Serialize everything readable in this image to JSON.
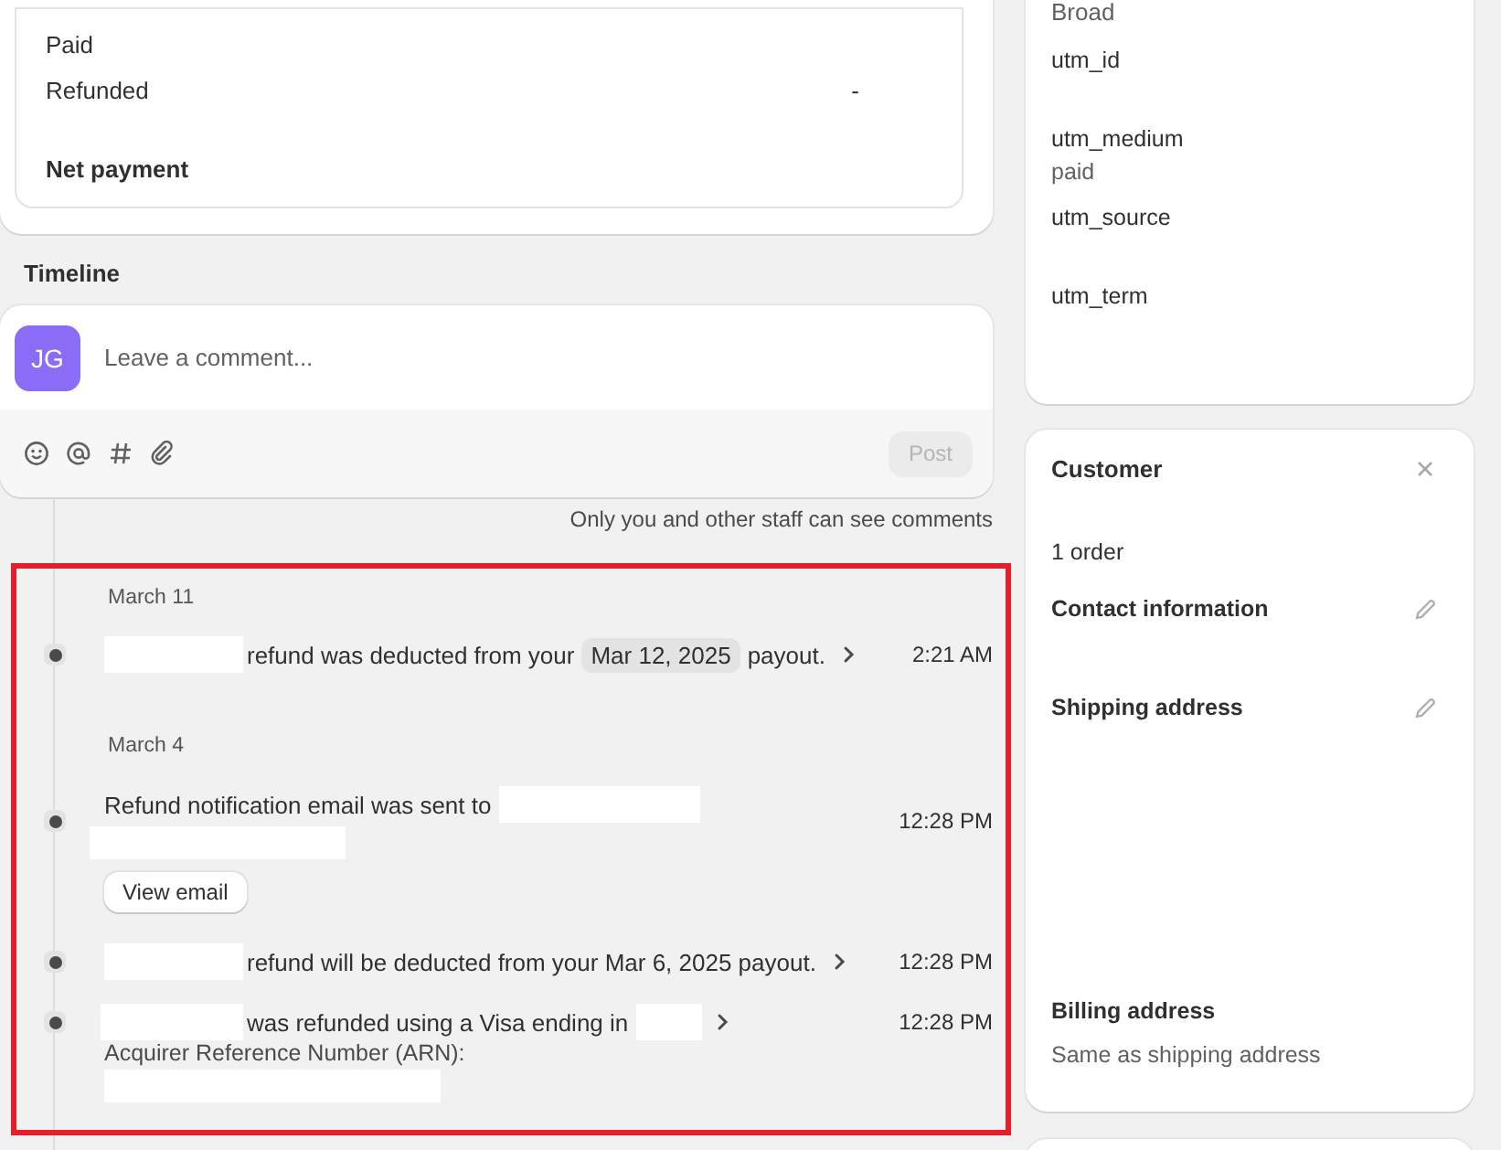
{
  "payment_summary": {
    "rows": [
      {
        "label": "Paid"
      },
      {
        "label": "Refunded",
        "value": "-"
      }
    ],
    "total": {
      "label": "Net payment"
    }
  },
  "timeline": {
    "title": "Timeline",
    "comment": {
      "avatar_initials": "JG",
      "placeholder": "Leave a comment...",
      "post_button": "Post",
      "post_disabled": true
    },
    "note": "Only you and other staff can see comments",
    "highlighted": true,
    "groups": [
      {
        "date": "March 11",
        "events": [
          {
            "parts": [
              {
                "kind": "redacted"
              },
              {
                "kind": "text",
                "text": "refund was deducted from your"
              },
              {
                "kind": "chip",
                "text": "Mar 12, 2025"
              },
              {
                "kind": "text",
                "text": "payout."
              }
            ],
            "link": true,
            "time": "2:21 AM"
          }
        ]
      },
      {
        "date": "March 4",
        "events": [
          {
            "parts": [
              {
                "kind": "text",
                "text": "Refund notification email was sent to"
              },
              {
                "kind": "redacted"
              }
            ],
            "extra": [
              {
                "kind": "redacted"
              }
            ],
            "button": "View email",
            "link": false,
            "time": "12:28 PM"
          },
          {
            "parts": [
              {
                "kind": "redacted"
              },
              {
                "kind": "text",
                "text": "refund will be deducted from your Mar 6, 2025 payout."
              }
            ],
            "link": true,
            "time": "12:28 PM"
          },
          {
            "parts": [
              {
                "kind": "redacted"
              },
              {
                "kind": "text",
                "text": "was refunded using a Visa ending in"
              },
              {
                "kind": "redacted"
              }
            ],
            "link": true,
            "time": "12:28 PM",
            "extra": [
              {
                "kind": "text",
                "text": "Acquirer Reference Number (ARN):"
              },
              {
                "kind": "redacted"
              }
            ]
          }
        ]
      }
    ]
  },
  "utm_card": {
    "top_value": "Broad",
    "fields": [
      {
        "label": "utm_id"
      },
      {
        "label": "utm_medium",
        "value": "paid"
      },
      {
        "label": "utm_source"
      },
      {
        "label": "utm_term"
      }
    ]
  },
  "customer": {
    "title": "Customer",
    "orders": "1 order",
    "sections": [
      {
        "title": "Contact information",
        "editable": true
      },
      {
        "title": "Shipping address",
        "editable": true
      },
      {
        "title": "Billing address",
        "editable": false,
        "value": "Same as shipping address"
      }
    ]
  }
}
